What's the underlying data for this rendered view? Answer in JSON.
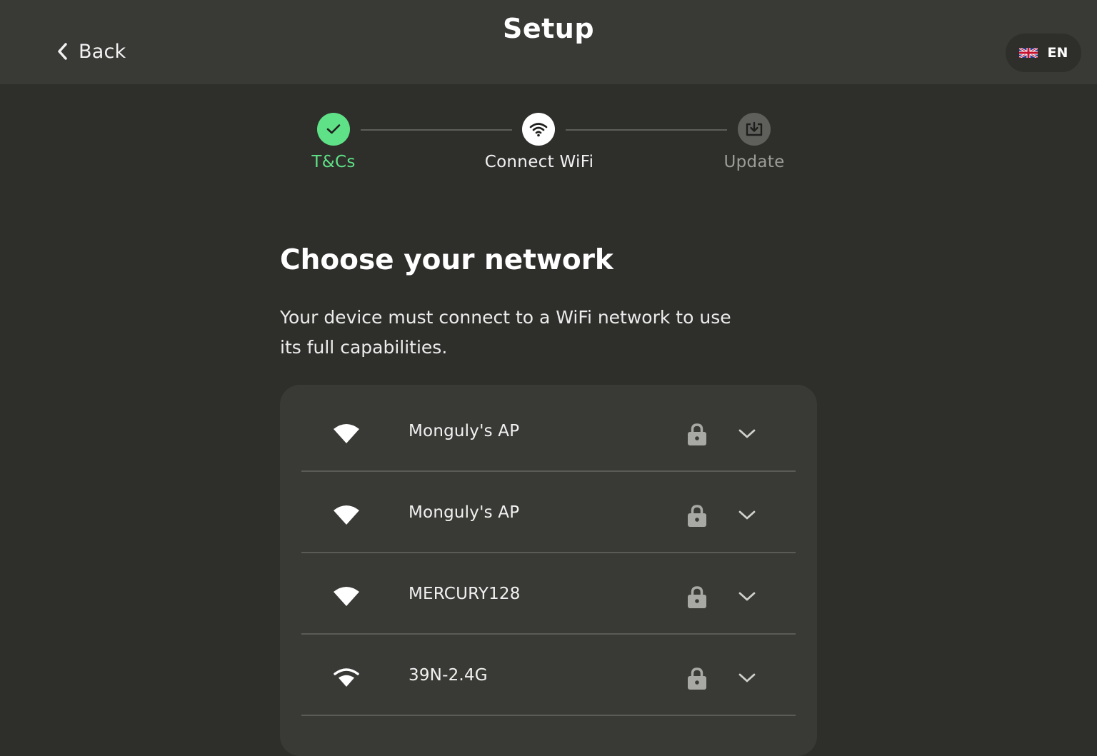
{
  "header": {
    "back_label": "Back",
    "title": "Setup",
    "language": "EN"
  },
  "stepper": {
    "steps": [
      {
        "label": "T&Cs",
        "state": "complete",
        "icon": "check-icon"
      },
      {
        "label": "Connect WiFi",
        "state": "current",
        "icon": "wifi-icon"
      },
      {
        "label": "Update",
        "state": "pending",
        "icon": "download-icon"
      }
    ]
  },
  "main": {
    "heading": "Choose your network",
    "description": "Your device must connect to a WiFi network to use its full capabilities."
  },
  "networks": [
    {
      "ssid": "Monguly's AP",
      "secured": true,
      "signal": "full"
    },
    {
      "ssid": "Monguly's AP",
      "secured": true,
      "signal": "full"
    },
    {
      "ssid": "MERCURY128",
      "secured": true,
      "signal": "full"
    },
    {
      "ssid": "39N-2.4G",
      "secured": true,
      "signal": "medium"
    }
  ],
  "colors": {
    "background": "#2e2e2b",
    "header": "#393936",
    "accent_green": "#5fe287",
    "muted_text": "#9c9c98"
  }
}
